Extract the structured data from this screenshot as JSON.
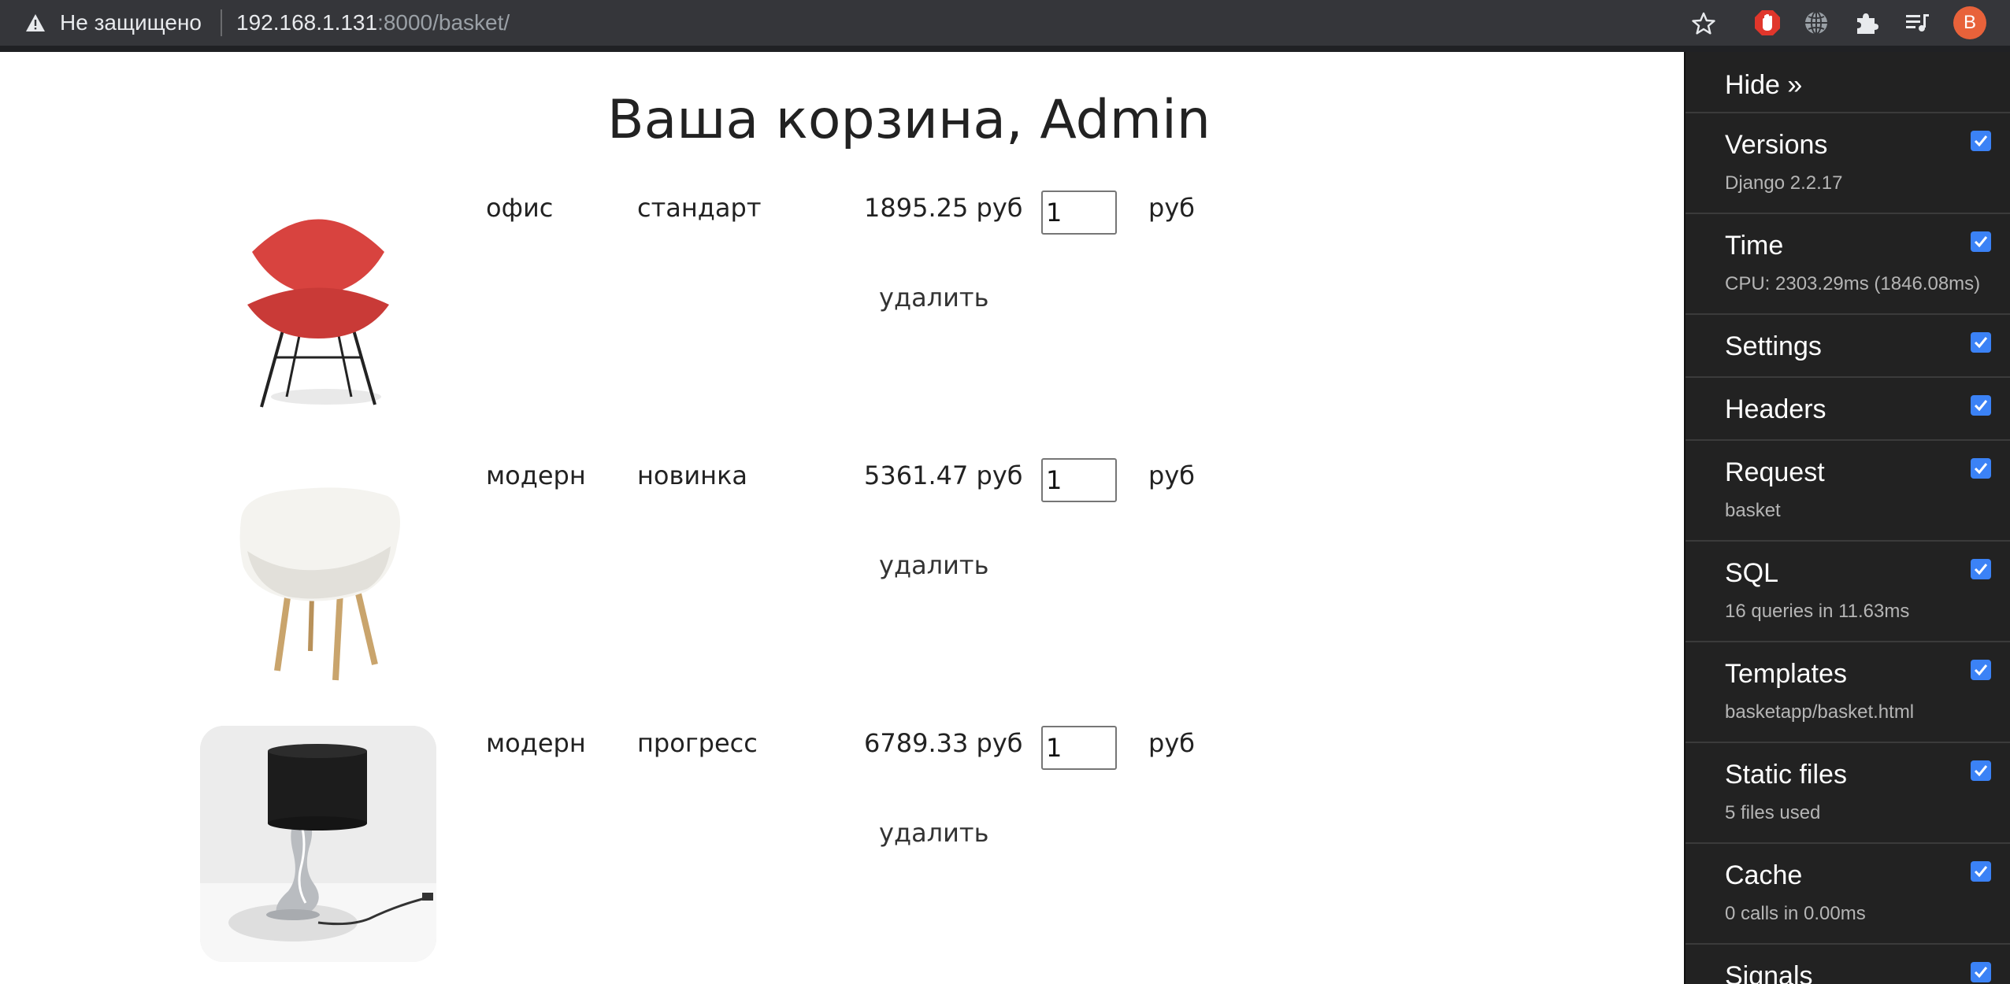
{
  "browser": {
    "security_text": "Не защищено",
    "url_host": "192.168.1.131",
    "url_rest": ":8000/basket/",
    "avatar_letter": "B",
    "icons": [
      "warning-icon",
      "star-icon",
      "stop-hand-icon",
      "globe-icon",
      "puzzle-icon",
      "queue-icon"
    ]
  },
  "page": {
    "title": "Ваша корзина, Admin"
  },
  "basket": {
    "items": [
      {
        "category": "офис",
        "name": "стандарт",
        "price": "1895.25 руб",
        "quantity": "1",
        "currency": "руб",
        "delete_label": "удалить",
        "image": "red-chair"
      },
      {
        "category": "модерн",
        "name": "новинка",
        "price": "5361.47 руб",
        "quantity": "1",
        "currency": "руб",
        "delete_label": "удалить",
        "image": "white-chair"
      },
      {
        "category": "модерн",
        "name": "прогресс",
        "price": "6789.33 руб",
        "quantity": "1",
        "currency": "руб",
        "delete_label": "удалить",
        "image": "table-lamp"
      }
    ]
  },
  "debug_toolbar": {
    "hide_label": "Hide »",
    "panels": [
      {
        "title": "Versions",
        "subtitle": "Django 2.2.17",
        "checked": true
      },
      {
        "title": "Time",
        "subtitle": "CPU: 2303.29ms (1846.08ms)",
        "checked": true
      },
      {
        "title": "Settings",
        "checked": true
      },
      {
        "title": "Headers",
        "checked": true
      },
      {
        "title": "Request",
        "subtitle": "basket",
        "checked": true
      },
      {
        "title": "SQL",
        "subtitle": "16 queries in 11.63ms",
        "checked": true
      },
      {
        "title": "Templates",
        "subtitle": "basketapp/basket.html",
        "checked": true
      },
      {
        "title": "Static files",
        "subtitle": "5 files used",
        "checked": true
      },
      {
        "title": "Cache",
        "subtitle": "0 calls in 0.00ms",
        "checked": true
      },
      {
        "title": "Signals",
        "checked": true
      }
    ]
  },
  "colors": {
    "browser_bar": "#35363a",
    "toolbar_bg": "#222222",
    "checkbox": "#3b82f6",
    "avatar": "#e8623a"
  }
}
